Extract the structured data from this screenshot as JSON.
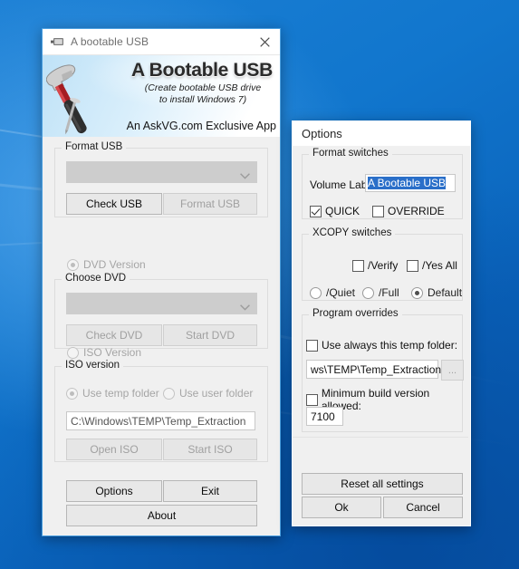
{
  "desktop": {
    "wallpaper": "windows-10-blue-hero"
  },
  "main_window": {
    "title": "A bootable USB",
    "title_icon": "usb-drive-icon",
    "close_icon": "close-icon",
    "banner": {
      "title": "A Bootable USB",
      "subtitle_line1": "(Create bootable USB drive",
      "subtitle_line2": "to install Windows 7)",
      "tagline": "An AskVG.com Exclusive App",
      "art": "hammer-and-nail-icon"
    },
    "format_group": {
      "legend": "Format USB",
      "dropdown_value": "",
      "dropdown_icon": "chevron-down-icon",
      "check_button": "Check USB",
      "format_button": "Format USB"
    },
    "dvd_radio": "DVD Version",
    "dvd_group": {
      "legend": "Choose DVD",
      "dropdown_value": "",
      "dropdown_icon": "chevron-down-icon",
      "check_button": "Check DVD",
      "start_button": "Start DVD"
    },
    "iso_radio": "ISO Version",
    "iso_group": {
      "legend": "ISO version",
      "radio_temp": "Use temp folder",
      "radio_user": "Use user folder",
      "path_value": "C:\\Windows\\TEMP\\Temp_Extraction",
      "open_button": "Open ISO",
      "start_button": "Start ISO"
    },
    "footer": {
      "options": "Options",
      "exit": "Exit",
      "about": "About"
    }
  },
  "options_window": {
    "title": "Options",
    "format_switches": {
      "legend": "Format switches",
      "volume_label_caption": "Volume Label:",
      "volume_label_value": "A Bootable USB",
      "quick": "QUICK",
      "override": "OVERRIDE"
    },
    "xcopy_switches": {
      "legend": "XCOPY switches",
      "verify": "/Verify",
      "yes_all": "/Yes All",
      "quiet": "/Quiet",
      "full": "/Full",
      "default": "Default"
    },
    "program_overrides": {
      "legend": "Program overrides",
      "temp_folder_check": "Use always this temp folder:",
      "temp_folder_value": "ws\\TEMP\\Temp_Extraction",
      "browse_button": "...",
      "min_build_check": "Minimum build version allowed:",
      "min_build_value": "7100"
    },
    "footer": {
      "reset": "Reset all settings",
      "ok": "Ok",
      "cancel": "Cancel"
    }
  }
}
